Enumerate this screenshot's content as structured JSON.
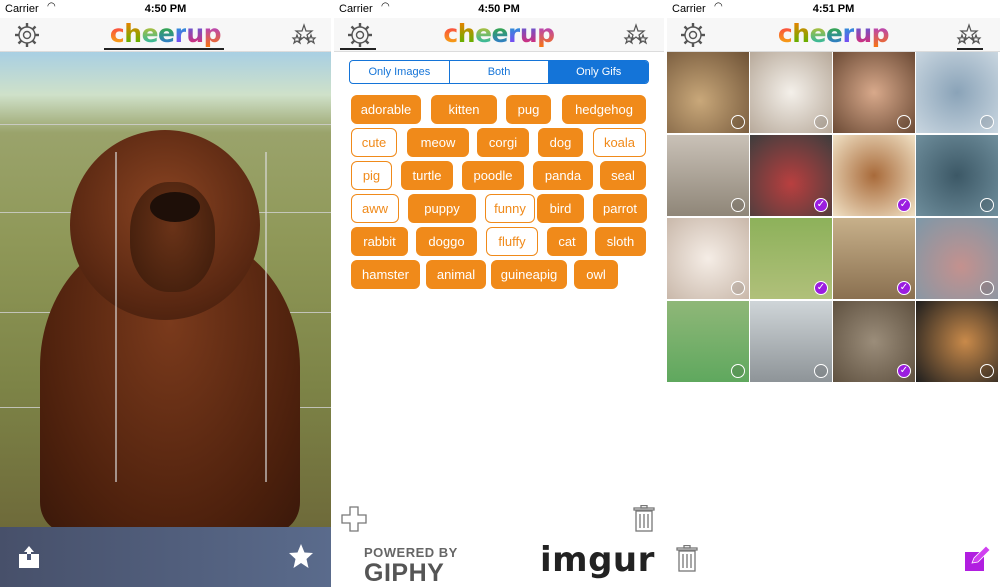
{
  "screens": [
    {
      "status": {
        "carrier": "Carrier",
        "time": "4:50 PM"
      },
      "logo": "cheerup"
    },
    {
      "status": {
        "carrier": "Carrier",
        "time": "4:50 PM"
      },
      "logo": "cheerup",
      "segments": [
        "Only Images",
        "Both",
        "Only Gifs"
      ],
      "selected_segment": "Only Gifs",
      "tags": [
        {
          "label": "adorable",
          "selected": true
        },
        {
          "label": "kitten",
          "selected": true
        },
        {
          "label": "pug",
          "selected": true
        },
        {
          "label": "hedgehog",
          "selected": true
        },
        {
          "label": "cute",
          "selected": false
        },
        {
          "label": "meow",
          "selected": true
        },
        {
          "label": "corgi",
          "selected": true
        },
        {
          "label": "dog",
          "selected": true
        },
        {
          "label": "koala",
          "selected": false
        },
        {
          "label": "pig",
          "selected": false
        },
        {
          "label": "turtle",
          "selected": true
        },
        {
          "label": "poodle",
          "selected": true
        },
        {
          "label": "panda",
          "selected": true
        },
        {
          "label": "seal",
          "selected": true
        },
        {
          "label": "aww",
          "selected": false
        },
        {
          "label": "puppy",
          "selected": true
        },
        {
          "label": "funny",
          "selected": false
        },
        {
          "label": "bird",
          "selected": true
        },
        {
          "label": "parrot",
          "selected": true
        },
        {
          "label": "rabbit",
          "selected": true
        },
        {
          "label": "doggo",
          "selected": true
        },
        {
          "label": "fluffy",
          "selected": false
        },
        {
          "label": "cat",
          "selected": true
        },
        {
          "label": "sloth",
          "selected": true
        },
        {
          "label": "hamster",
          "selected": true
        },
        {
          "label": "animal",
          "selected": true
        },
        {
          "label": "guineapig",
          "selected": true
        },
        {
          "label": "owl",
          "selected": true
        }
      ],
      "giphy": {
        "line1": "POWERED BY",
        "line2": "GIPHY"
      },
      "imgur": "imgur"
    },
    {
      "status": {
        "carrier": "Carrier",
        "time": "4:51 PM"
      },
      "logo": "cheerup",
      "grid_checked": [
        false,
        false,
        false,
        false,
        false,
        true,
        true,
        false,
        false,
        true,
        true,
        false,
        false,
        false,
        true,
        false
      ]
    }
  ],
  "colors": {
    "accent_orange": "#f08a1a",
    "segment_blue": "#1474d8",
    "check_purple": "#9b1de0"
  },
  "icons": [
    "gear-icon",
    "stars-icon",
    "share-icon",
    "star-icon",
    "plus-icon",
    "trash-icon",
    "edit-icon"
  ]
}
